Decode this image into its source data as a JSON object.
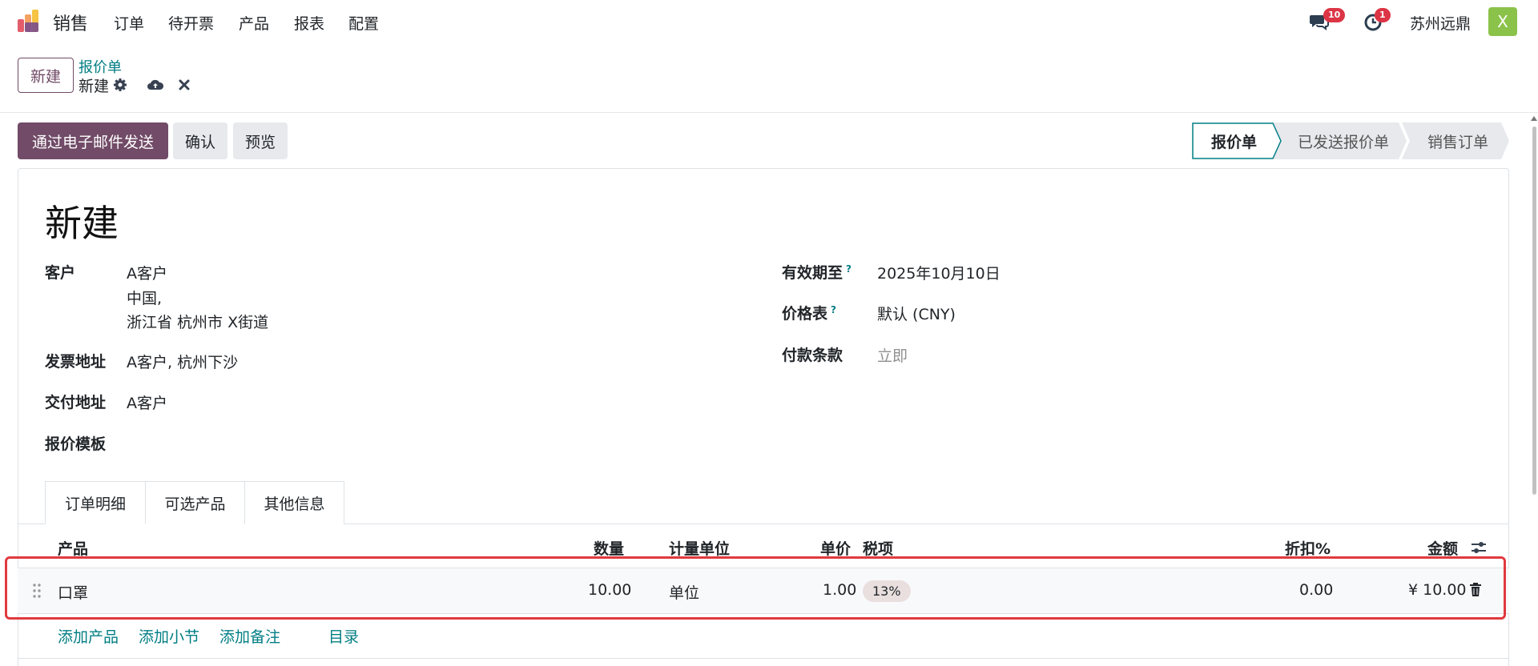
{
  "topnav": {
    "app_name": "销售",
    "menu": [
      "订单",
      "待开票",
      "产品",
      "报表",
      "配置"
    ],
    "messages_badge": "10",
    "activities_badge": "1",
    "company": "苏州远鼎",
    "avatar_letter": "X"
  },
  "control": {
    "new_label": "新建",
    "breadcrumb_parent": "报价单",
    "breadcrumb_current": "新建"
  },
  "actions": {
    "send_email": "通过电子邮件发送",
    "confirm": "确认",
    "preview": "预览"
  },
  "statusbar": [
    "报价单",
    "已发送报价单",
    "销售订单"
  ],
  "form": {
    "title": "新建",
    "customer_label": "客户",
    "customer_lines": [
      "A客户",
      "中国,",
      "浙江省 杭州市 X街道"
    ],
    "invoice_address_label": "发票地址",
    "invoice_address": "A客户, 杭州下沙",
    "delivery_address_label": "交付地址",
    "delivery_address": "A客户",
    "quote_template_label": "报价模板",
    "expiration_label": "有效期至",
    "expiration": "2025年10月10日",
    "pricelist_label": "价格表",
    "pricelist": "默认 (CNY)",
    "payment_terms_label": "付款条款",
    "payment_terms_placeholder": "立即",
    "help_mark": "?"
  },
  "tabs": [
    "订单明细",
    "可选产品",
    "其他信息"
  ],
  "table": {
    "headers": {
      "product": "产品",
      "quantity": "数量",
      "uom": "计量单位",
      "unit_price": "单价",
      "taxes": "税项",
      "discount": "折扣%",
      "amount": "金额"
    },
    "rows": [
      {
        "product": "口罩",
        "quantity": "10.00",
        "uom": "单位",
        "unit_price": "1.00",
        "tax": "13%",
        "discount": "0.00",
        "amount": "¥ 10.00"
      }
    ],
    "add_product": "添加产品",
    "add_section": "添加小节",
    "add_note": "添加备注",
    "catalog": "目录"
  },
  "colors": {
    "primary": "#714b67",
    "link": "#017e84",
    "badge": "#dc3545",
    "highlight": "#e03a3e",
    "avatar": "#8bc34a"
  }
}
